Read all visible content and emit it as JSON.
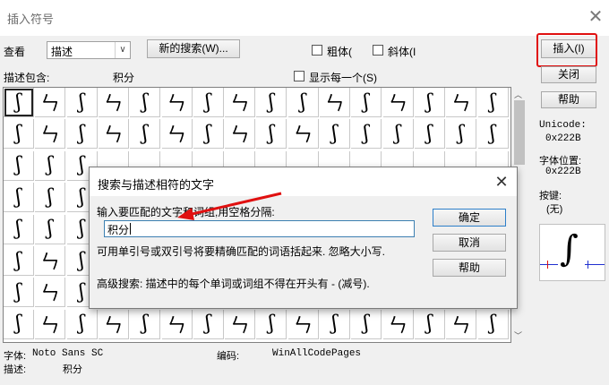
{
  "window": {
    "title": "插入符号"
  },
  "toolbar": {
    "view_label": "查看",
    "view_value": "描述",
    "new_search_button": "新的搜索(W)...",
    "bold_label": "粗体(",
    "italic_label": "斜体(I",
    "insert_button": "插入(I)",
    "close_button": "关闭",
    "help_button": "帮助"
  },
  "description": {
    "label": "描述包含:",
    "value": "积分",
    "show_each_label": "显示每一个(S)"
  },
  "grid": {
    "rows": [
      [
        "ʃ",
        "ㄣ",
        "ʃ",
        "ㄣ",
        "ʃ",
        "ㄣ",
        "ʃ",
        "ㄣ",
        "ʃ",
        "ʃ",
        "ㄣ",
        "ʃ",
        "ㄣ",
        "ʃ",
        "ㄣ",
        "ʃ"
      ],
      [
        "ʃ",
        "ㄣ",
        "ʃ",
        "ㄣ",
        "ʃ",
        "ㄣ",
        "ʃ",
        "ㄣ",
        "ʃ",
        "ㄣ",
        "ʃ",
        "ʃ",
        "ʃ",
        "ʃ",
        "ʃ",
        "ʃ"
      ],
      [
        "ʃ",
        "ʃ",
        "ʃ",
        "",
        "",
        "",
        "",
        "",
        "",
        "",
        "",
        "",
        "",
        "",
        "",
        ""
      ],
      [
        "ʃ",
        "ʃ",
        "ʃ",
        "",
        "",
        "",
        "",
        "",
        "",
        "",
        "",
        "",
        "",
        "",
        "",
        ""
      ],
      [
        "ʃ",
        "ʃ",
        "ʃ",
        "",
        "",
        "",
        "",
        "",
        "",
        "",
        "",
        "",
        "",
        "",
        "",
        ""
      ],
      [
        "ʃ",
        "ㄣ",
        "ʃ",
        "",
        "",
        "",
        "",
        "",
        "",
        "",
        "",
        "",
        "",
        "",
        "",
        ""
      ],
      [
        "ʃ",
        "ㄣ",
        "ʃ",
        "",
        "",
        "",
        "",
        "",
        "",
        "",
        "",
        "",
        "",
        "",
        "",
        ""
      ],
      [
        "ʃ",
        "ㄣ",
        "ʃ",
        "ㄣ",
        "ʃ",
        "ㄣ",
        "ʃ",
        "ㄣ",
        "ʃ",
        "ㄣ",
        "ʃ",
        "ʃ",
        "ㄣ",
        "ʃ",
        "ㄣ",
        "ʃ"
      ]
    ]
  },
  "side": {
    "unicode_label": "Unicode:",
    "unicode_value": "0x222B",
    "charpos_label": "字体位置:",
    "charpos_value": "0x222B",
    "key_label": "按键:",
    "key_value": "(无)",
    "preview_glyph": "∫"
  },
  "footer": {
    "font_label": "字体:",
    "font_value": "Noto Sans SC",
    "encoding_label": "编码:",
    "encoding_value": "WinAllCodePages",
    "desc_label": "描述:",
    "desc_value": "积分"
  },
  "dialog": {
    "title": "搜索与描述相符的文字",
    "prompt": "输入要匹配的文字和词组,用空格分隔:",
    "input_value": "积分",
    "hint": "可用单引号或双引号将要精确匹配的词语括起来. 忽略大小写.",
    "advanced": "高级搜索: 描述中的每个单词或词组不得在开头有 - (减号).",
    "ok_button": "确定",
    "cancel_button": "取消",
    "help_button": "帮助"
  },
  "colors": {
    "annotation": "#e01010",
    "input_border": "#3c7fb1"
  }
}
